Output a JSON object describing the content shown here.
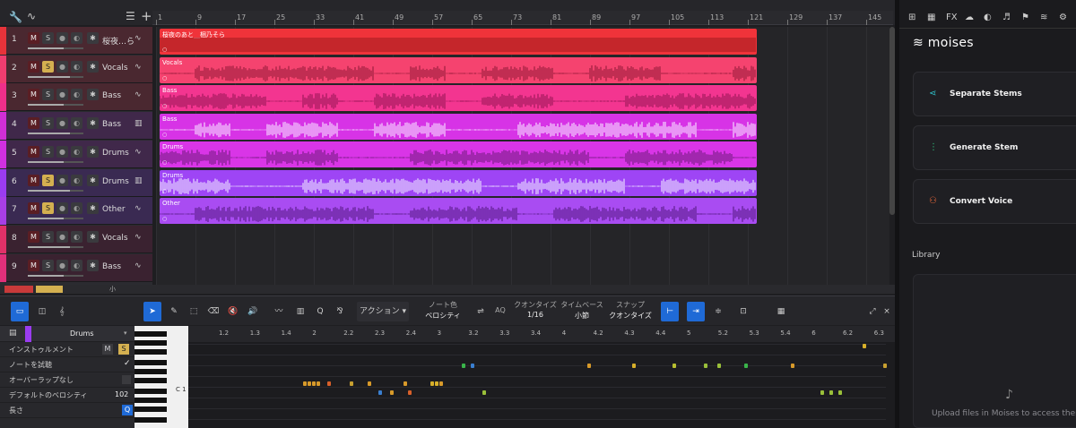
{
  "ruler": {
    "bars": [
      "1",
      "9",
      "17",
      "25",
      "33",
      "41",
      "49",
      "57",
      "65",
      "73",
      "81",
      "89",
      "97",
      "105",
      "113",
      "121",
      "129",
      "137",
      "145"
    ]
  },
  "tracks": [
    {
      "num": "1",
      "name": "桜夜…ら",
      "color": "#e8333a",
      "solo": false
    },
    {
      "num": "2",
      "name": "Vocals",
      "color": "#f03d6f",
      "solo": true
    },
    {
      "num": "3",
      "name": "Bass",
      "color": "#ee2f8a",
      "solo": false
    },
    {
      "num": "4",
      "name": "Bass",
      "color": "#d02fd6",
      "solo": false
    },
    {
      "num": "5",
      "name": "Drums",
      "color": "#d030e0",
      "solo": false
    },
    {
      "num": "6",
      "name": "Drums",
      "color": "#9a3cf0",
      "solo": true
    },
    {
      "num": "7",
      "name": "Other",
      "color": "#a73fe5",
      "solo": true
    },
    {
      "num": "8",
      "name": "Vocals",
      "color": "#e03168",
      "solo": false
    },
    {
      "num": "9",
      "name": "Bass",
      "color": "#e0307a",
      "solo": false
    }
  ],
  "clips": [
    {
      "name": "桜夜のあと__梱乃そら",
      "color": "#f0333a",
      "wave": "#a81e22"
    },
    {
      "name": "Vocals",
      "color": "#f5436f",
      "wave": "#9e1f3f"
    },
    {
      "name": "Bass",
      "color": "#f33590",
      "wave": "#a01a5c"
    },
    {
      "name": "Bass",
      "color": "#d733e6",
      "wave": "#f5d6ff"
    },
    {
      "name": "Drums",
      "color": "#d935e7",
      "wave": "#7c1e88"
    },
    {
      "name": "Drums",
      "color": "#9e45f5",
      "wave": "#e9dcff"
    },
    {
      "name": "Other",
      "color": "#a94cf2",
      "wave": "#5e1f8e"
    }
  ],
  "toolbar": {
    "action": "アクション",
    "note_color_label": "ノート色",
    "note_color_value": "ベロシティ",
    "aq": "AQ",
    "quantize_label": "クオンタイズ",
    "quantize_value": "1/16",
    "timebase_label": "タイムベース",
    "timebase_value": "小節",
    "snap_label": "スナップ",
    "snap_value": "クオンタイズ"
  },
  "inspector": {
    "track": "Drums",
    "instrument": "インストゥルメント",
    "audition": "ノートを試聴",
    "overlap": "オーバーラップなし",
    "default_velocity": "デフォルトのベロシティ",
    "default_velocity_value": "102",
    "length": "長さ",
    "m": "M",
    "s": "S"
  },
  "piano": {
    "c1": "C 1"
  },
  "editor_ruler": [
    "1.2",
    "1.3",
    "1.4",
    "2",
    "2.2",
    "2.3",
    "2.4",
    "3",
    "3.2",
    "3.3",
    "3.4",
    "4",
    "4.2",
    "4.3",
    "4.4",
    "5",
    "5.2",
    "5.3",
    "5.4",
    "6",
    "6.2",
    "6.3"
  ],
  "panel": {
    "tabs": [
      "⊞",
      "▦",
      "FX",
      "☁",
      "◐",
      "♬",
      "⚑",
      "≋",
      "⚙"
    ],
    "brand": "moises",
    "actions": [
      {
        "label": "Separate Stems",
        "icon": "share-icon",
        "color": "#2fc0c8"
      },
      {
        "label": "Generate Stem",
        "icon": "wave-icon",
        "color": "#2fc07a"
      },
      {
        "label": "Convert Voice",
        "icon": "person-icon",
        "color": "#f06a3a"
      }
    ],
    "library_title": "Library",
    "library_empty": "Upload files in Moises to access them h"
  },
  "footer": {
    "small": "小"
  }
}
